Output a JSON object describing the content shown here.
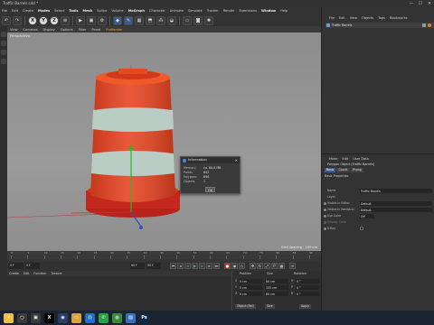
{
  "window": {
    "title": "Traffic Barrels.c4d *",
    "close": "✕",
    "minimize": "—",
    "maximize": "☐"
  },
  "menubar": [
    "File",
    "Edit",
    "Create",
    "Modes",
    "Select",
    "Tools",
    "Mesh",
    "Spline",
    "Volume",
    "MoGraph",
    "Character",
    "Animate",
    "Simulate",
    "Tracker",
    "Render",
    "Extensions",
    "Window",
    "Help"
  ],
  "toolbar_icons": [
    "undo-icon",
    "redo-icon",
    "x-axis-icon",
    "y-axis-icon",
    "z-axis-icon",
    "coordinate-system-icon",
    "render-view-icon",
    "render-picture-icon",
    "render-settings-icon",
    "cube-icon",
    "pen-icon",
    "subdivision-icon",
    "extrude-icon",
    "cloner-icon",
    "deformer-icon",
    "floor-icon",
    "camera-icon",
    "light-icon"
  ],
  "viewport": {
    "menu": [
      "View",
      "Cameras",
      "Display",
      "Options",
      "Filter",
      "Panel",
      "ProRender"
    ],
    "camera_label": "Perspective",
    "grid_spacing": "Grid Spacing : 100 cm"
  },
  "dialog": {
    "title": "Information",
    "close": "✕",
    "rows": [
      {
        "key": "Memory",
        "value": "ca. 60.8 MB"
      },
      {
        "key": "Points",
        "value": "642"
      },
      {
        "key": "Polygons",
        "value": "696"
      },
      {
        "key": "Objects",
        "value": "1"
      }
    ],
    "ok_label": "OK"
  },
  "timeline": {
    "ticks": [
      "0",
      "5",
      "10",
      "15",
      "20",
      "25",
      "30",
      "35",
      "40",
      "45",
      "50",
      "55",
      "60",
      "65",
      "70",
      "75",
      "80",
      "85",
      "90"
    ],
    "start_frame": "0 F",
    "current_frame": "0 F",
    "end_frame": "90 F",
    "end_frame2": "90 F"
  },
  "bottom_panel": {
    "menu": [
      "Create",
      "Edit",
      "Function",
      "Texture"
    ]
  },
  "coords": {
    "headers": [
      "Position",
      "Size",
      "Rotation"
    ],
    "rows": [
      {
        "axis": "X",
        "pos": "0 cm",
        "size": "80 cm",
        "rot_label": "H",
        "rot": "0 °"
      },
      {
        "axis": "Y",
        "pos": "0 cm",
        "size": "105 cm",
        "rot_label": "P",
        "rot": "0 °"
      },
      {
        "axis": "Z",
        "pos": "0 cm",
        "size": "80 cm",
        "rot_label": "B",
        "rot": "0 °"
      }
    ],
    "mode": "Object (Rel)",
    "size_mode": "Size",
    "apply": "Apply"
  },
  "object_manager": {
    "menu": [
      "File",
      "Edit",
      "View",
      "Objects",
      "Tags",
      "Bookmarks"
    ],
    "object_name": "Traffic Barrels"
  },
  "attributes": {
    "menu": [
      "Mode",
      "Edit",
      "User Data"
    ],
    "object_title": "Polygon Object [Traffic Barrels]",
    "tabs": [
      "Basic",
      "Coord.",
      "Phong"
    ],
    "section": "Basic Properties",
    "rows": [
      {
        "label": "Name",
        "value": "Traffic Barrels"
      },
      {
        "label": "Layer",
        "value": ""
      },
      {
        "label": "Visible in Editor",
        "value": "Default"
      },
      {
        "label": "Visible in Renderer",
        "value": "Default"
      },
      {
        "label": "Use Color",
        "value": "Off"
      },
      {
        "label": "Display Color",
        "value": ""
      },
      {
        "label": "X-Ray",
        "value": ""
      }
    ]
  },
  "taskbar": [
    {
      "name": "start-icon",
      "glyph": "✦",
      "color": "#f0c040"
    },
    {
      "name": "search-icon",
      "glyph": "○",
      "color": "#3a3a3a"
    },
    {
      "name": "taskview-icon",
      "glyph": "▣",
      "color": "#3a3a3a"
    },
    {
      "name": "x-app-icon",
      "glyph": "X",
      "color": "#000000"
    },
    {
      "name": "cinema4d-icon",
      "glyph": "◉",
      "color": "#2a3c6a"
    },
    {
      "name": "file-explorer-icon",
      "glyph": "▭",
      "color": "#d9a730"
    },
    {
      "name": "vscode-icon",
      "glyph": "⟨⟩",
      "color": "#1f6fd1"
    },
    {
      "name": "whatsapp-icon",
      "glyph": "✆",
      "color": "#25a244"
    },
    {
      "name": "chrome-icon",
      "glyph": "◍",
      "color": "#3c8a3c"
    },
    {
      "name": "photos-icon",
      "glyph": "▧",
      "color": "#3a6fbf"
    },
    {
      "name": "photoshop-icon",
      "glyph": "Ps",
      "color": "#0d2a4a"
    }
  ]
}
